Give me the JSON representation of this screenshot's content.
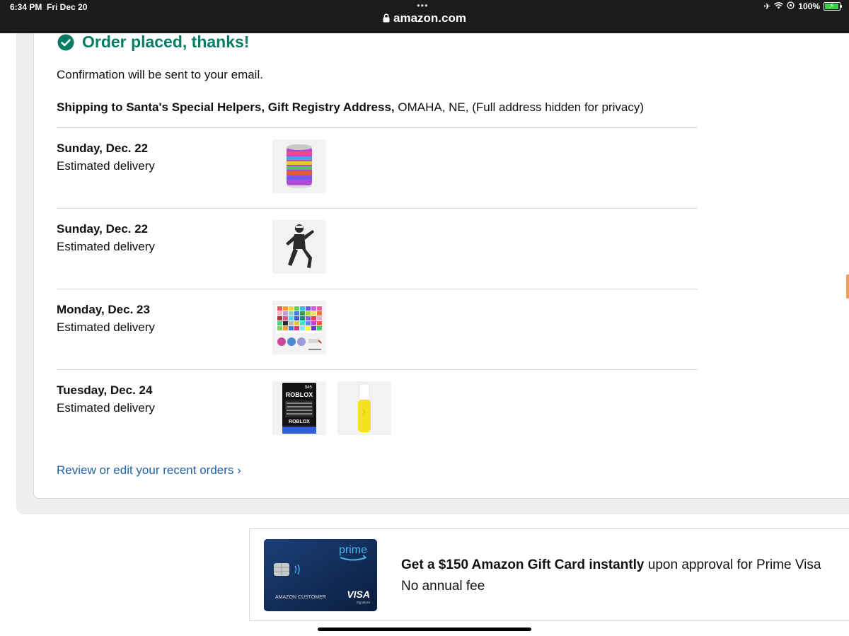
{
  "status_bar": {
    "time": "6:34 PM",
    "date": "Fri Dec 20",
    "url": "amazon.com",
    "battery": "100%",
    "battery_level": 1.0
  },
  "order": {
    "title": "Order placed, thanks!",
    "confirmation": "Confirmation will be sent to your email.",
    "shipping_bold": "Shipping to Santa's Special Helpers, Gift Registry Address,",
    "shipping_rest": " OMAHA, NE, (Full address hidden for privacy)",
    "deliveries": [
      {
        "date": "Sunday, Dec. 22",
        "label": "Estimated delivery",
        "items": [
          "elastic-cord-spool"
        ]
      },
      {
        "date": "Sunday, Dec. 22",
        "label": "Estimated delivery",
        "items": [
          "action-figure"
        ]
      },
      {
        "date": "Monday, Dec. 23",
        "label": "Estimated delivery",
        "items": [
          "bead-kit"
        ]
      },
      {
        "date": "Tuesday, Dec. 24",
        "label": "Estimated delivery",
        "items": [
          "roblox-gift-card",
          "yellow-mist-bottle"
        ]
      }
    ],
    "gift_card_text": {
      "brand": "ROBLOX",
      "amount": "$45"
    },
    "review_link": "Review or edit your recent orders",
    "review_chevron": "›"
  },
  "ad": {
    "card_prime": "prime",
    "card_name": "AMAZON CUSTOMER",
    "card_visa": "VISA",
    "card_visa_sub": "Signature",
    "headline_bold": "Get a $150 Amazon Gift Card instantly",
    "headline_rest": " upon approval for Prime Visa",
    "subline": "No annual fee"
  },
  "colors": {
    "success_green": "#067d62",
    "link_blue": "#2162a1",
    "topbar": "#1b1b1b"
  }
}
